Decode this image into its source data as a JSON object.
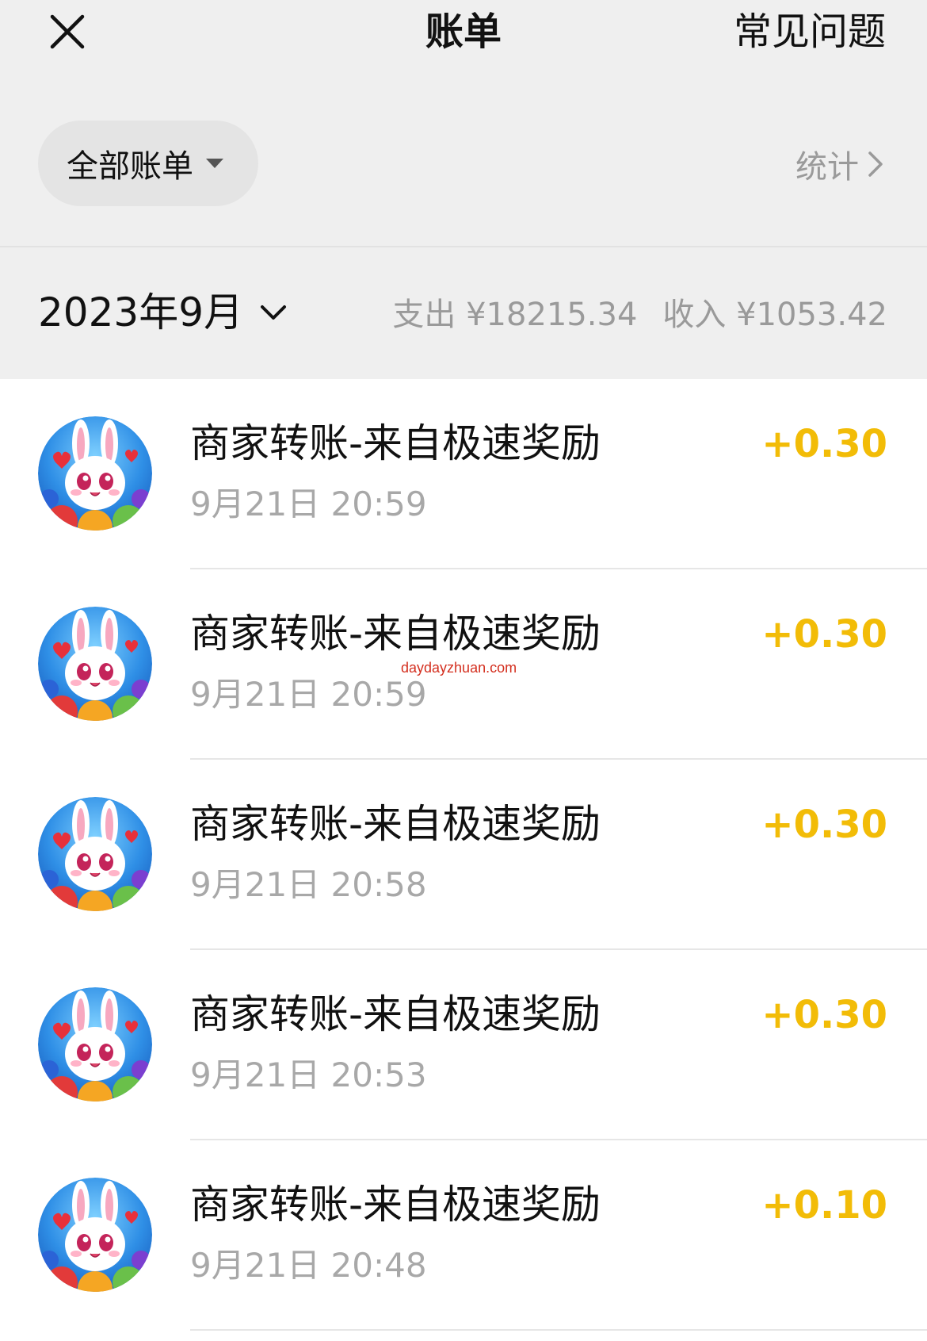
{
  "nav": {
    "title": "账单",
    "faq_label": "常见问题",
    "close_icon": "close-icon"
  },
  "filter": {
    "selected_label": "全部账单",
    "stats_label": "统计"
  },
  "summary": {
    "month_label": "2023年9月",
    "expense_text": "支出 ¥18215.34",
    "income_text": "收入 ¥1053.42"
  },
  "transactions": [
    {
      "title": "商家转账-来自极速奖励",
      "time": "9月21日 20:59",
      "amount": "+0.30",
      "avatar_icon": "bunny-avatar-icon"
    },
    {
      "title": "商家转账-来自极速奖励",
      "time": "9月21日 20:59",
      "amount": "+0.30",
      "avatar_icon": "bunny-avatar-icon"
    },
    {
      "title": "商家转账-来自极速奖励",
      "time": "9月21日 20:58",
      "amount": "+0.30",
      "avatar_icon": "bunny-avatar-icon"
    },
    {
      "title": "商家转账-来自极速奖励",
      "time": "9月21日 20:53",
      "amount": "+0.30",
      "avatar_icon": "bunny-avatar-icon"
    },
    {
      "title": "商家转账-来自极速奖励",
      "time": "9月21日 20:48",
      "amount": "+0.10",
      "avatar_icon": "bunny-avatar-icon"
    }
  ],
  "watermark": "daydayzhuan.com",
  "colors": {
    "header_bg": "#efefef",
    "amount": "#f2bc07",
    "muted_text": "#9a9a9a"
  }
}
